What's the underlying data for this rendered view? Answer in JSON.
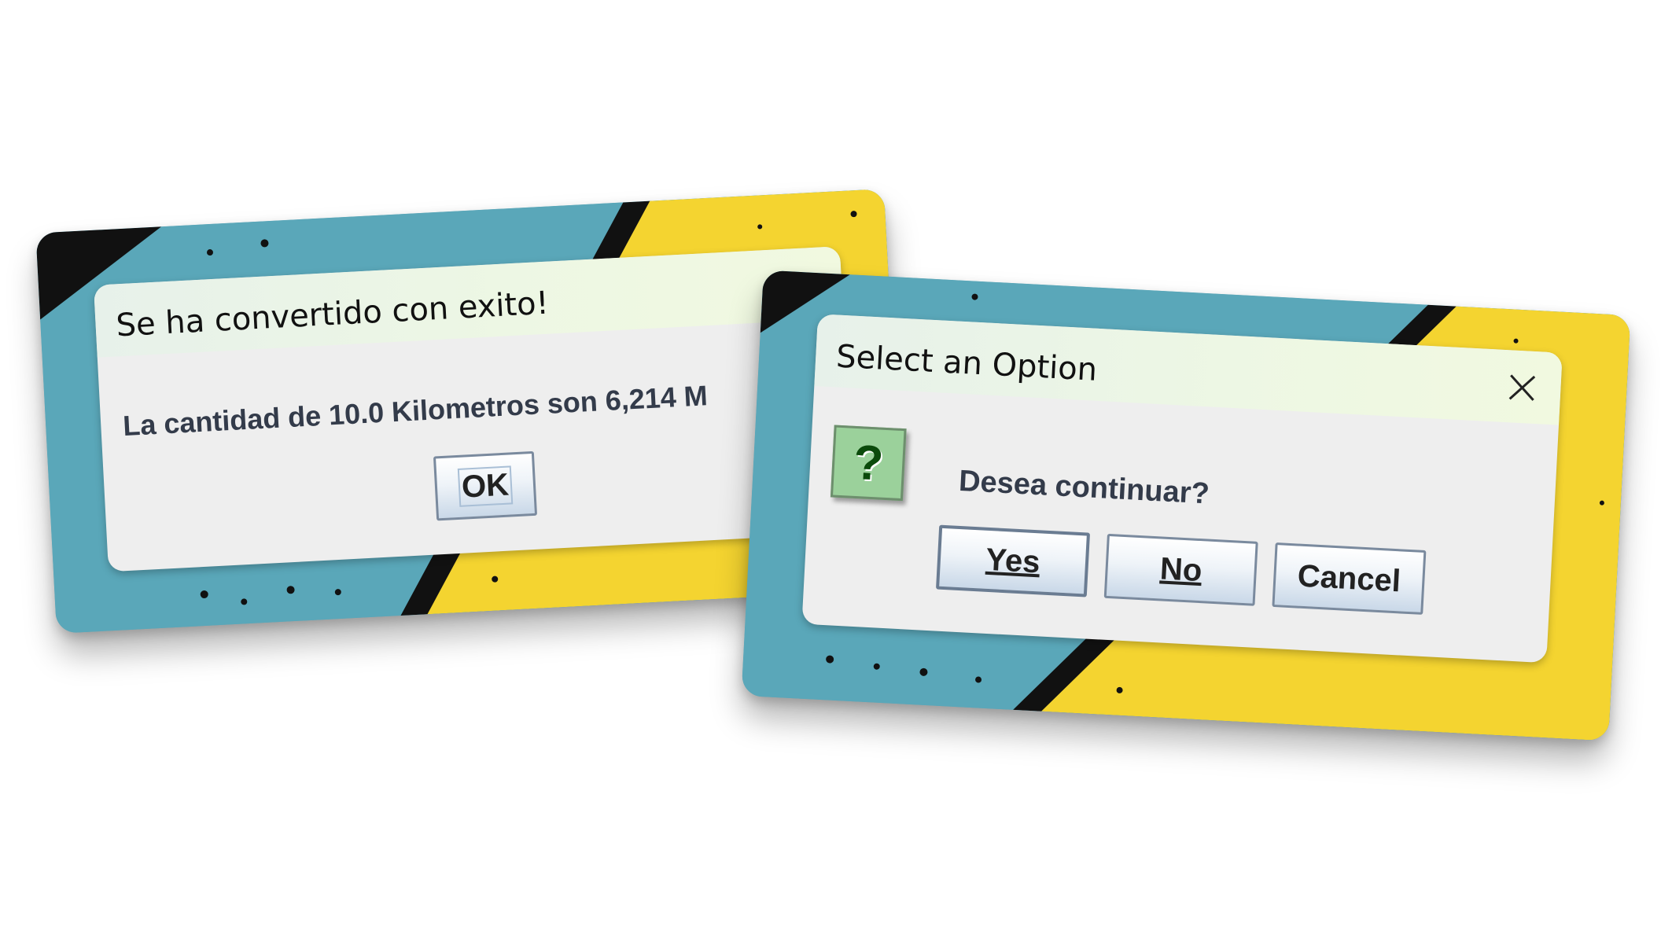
{
  "colors": {
    "teal": "#5aa7b9",
    "yellow": "#f4d430",
    "black": "#000000",
    "dialog_bg": "#eeeeee",
    "question_icon_bg": "#9bd19b"
  },
  "message_dialog": {
    "title": "Se ha convertido con exito!",
    "message": "La cantidad de 10.0 Kilometros son 6,214 M",
    "ok_label": "OK"
  },
  "option_dialog": {
    "title": "Select an Option",
    "icon": "question-icon",
    "icon_glyph": "?",
    "message": "Desea continuar?",
    "yes_label": "Yes",
    "no_label": "No",
    "cancel_label": "Cancel",
    "close_icon": "close-icon"
  }
}
